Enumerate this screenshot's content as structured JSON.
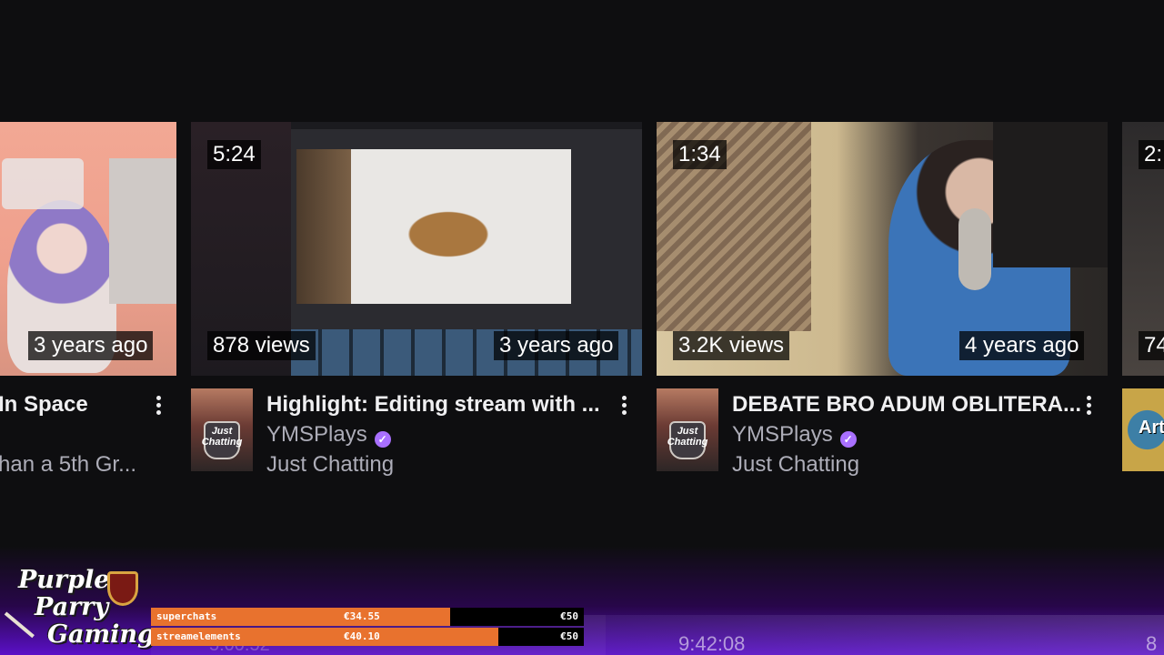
{
  "cards": [
    {
      "title_partial": "In Space",
      "subtitle_partial": "han a 5th Gr...",
      "age": "3 years ago"
    },
    {
      "duration": "5:24",
      "views": "878 views",
      "age": "3 years ago",
      "title": "Highlight: Editing stream with ...",
      "channel": "YMSPlays",
      "category": "Just Chatting",
      "avatar_text": "Just Chatting"
    },
    {
      "duration": "1:34",
      "views": "3.2K views",
      "age": "4 years ago",
      "title": "DEBATE BRO ADUM OBLITERA...",
      "channel": "YMSPlays",
      "category": "Just Chatting",
      "avatar_text": "Just Chatting"
    },
    {
      "duration_partial": "2:",
      "views_partial": "74",
      "avatar_text_partial": "Art"
    }
  ],
  "overlay": {
    "logo_lines": [
      "Purple",
      "Parry",
      "Gaming"
    ],
    "bars": [
      {
        "label": "superchats",
        "value": "€34.55",
        "goal": "€50",
        "progress": 0.691
      },
      {
        "label": "streamelements",
        "value": "€40.10",
        "goal": "€50",
        "progress": 0.802
      }
    ],
    "clock": "9:42:08",
    "clock_left_faded": "5:00:52",
    "edge_digit": "8"
  },
  "colors": {
    "background": "#0e0e10",
    "accent_purple": "#a970ff",
    "bar_fill": "#e8722e",
    "overlay_purple": "#5b10c8"
  }
}
